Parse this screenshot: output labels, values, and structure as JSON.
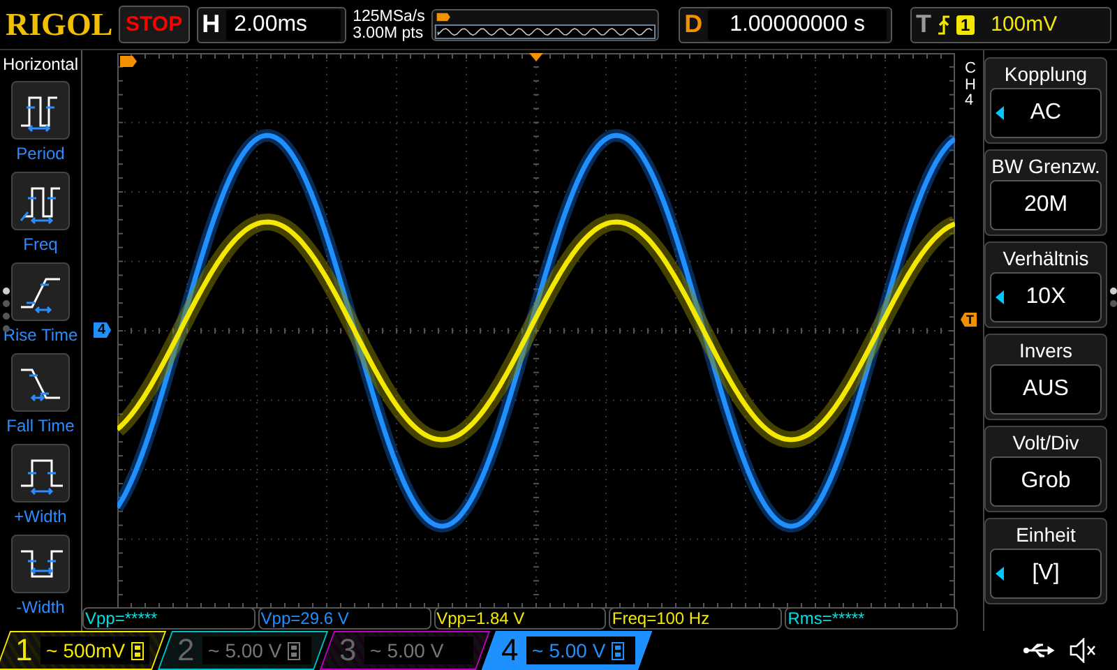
{
  "header": {
    "logo": "RIGOL",
    "run_state": "STOP",
    "timebase": {
      "label": "H",
      "value": "2.00ms"
    },
    "sample_rate": "125MSa/s",
    "memory_depth": "3.00M pts",
    "delay": {
      "label": "D",
      "value": "1.00000000 s"
    },
    "trigger": {
      "label": "T",
      "source": "1",
      "level": "100mV"
    }
  },
  "sidebar": {
    "title": "Horizontal",
    "items": [
      {
        "kind": "period",
        "label": "Period"
      },
      {
        "kind": "freq",
        "label": "Freq"
      },
      {
        "kind": "rise",
        "label": "Rise Time"
      },
      {
        "kind": "fall",
        "label": "Fall Time"
      },
      {
        "kind": "pwidth",
        "label": "+Width"
      },
      {
        "kind": "nwidth",
        "label": "-Width"
      }
    ],
    "page_dots": [
      {
        "selected": true
      },
      {
        "selected": false
      },
      {
        "selected": false
      },
      {
        "selected": false
      }
    ]
  },
  "display": {
    "channel_marker": "4",
    "trigger_marker": "T"
  },
  "measurements": [
    {
      "text": "Vpp=*****",
      "color": "#00e0e0"
    },
    {
      "text": "Vpp=29.6 V",
      "color": "#1e90ff"
    },
    {
      "text": "Vpp=1.84 V",
      "color": "#f5e800"
    },
    {
      "text": "Freq=100 Hz",
      "color": "#f5e800"
    },
    {
      "text": "Rms=*****",
      "color": "#00e0e0"
    }
  ],
  "channels": [
    {
      "number": "1",
      "coupling": "~",
      "scale": "500mV",
      "on": true,
      "selected": false,
      "bw_limit": true,
      "color": "#f5e800"
    },
    {
      "number": "2",
      "coupling": "~",
      "scale": "5.00 V",
      "on": false,
      "selected": false,
      "bw_limit": true,
      "color": "#00c0c0"
    },
    {
      "number": "3",
      "coupling": "~",
      "scale": "5.00 V",
      "on": false,
      "selected": false,
      "bw_limit": false,
      "color": "#c000c0"
    },
    {
      "number": "4",
      "coupling": "~",
      "scale": "5.00 V",
      "on": true,
      "selected": true,
      "bw_limit": true,
      "color": "#1e90ff"
    }
  ],
  "menu": {
    "channel": "CH4",
    "items": [
      {
        "title": "Kopplung",
        "value": "AC",
        "adjustable": true
      },
      {
        "title": "BW Grenzw.",
        "value": "20M",
        "adjustable": false
      },
      {
        "title": "Verhältnis",
        "value": "10X",
        "adjustable": true
      },
      {
        "title": "Invers",
        "value": "AUS",
        "adjustable": false
      },
      {
        "title": "Volt/Div",
        "value": "Grob",
        "adjustable": false
      },
      {
        "title": "Einheit",
        "value": "[V]",
        "adjustable": true
      }
    ],
    "page_dots": [
      {
        "selected": true
      },
      {
        "selected": false
      }
    ]
  }
}
